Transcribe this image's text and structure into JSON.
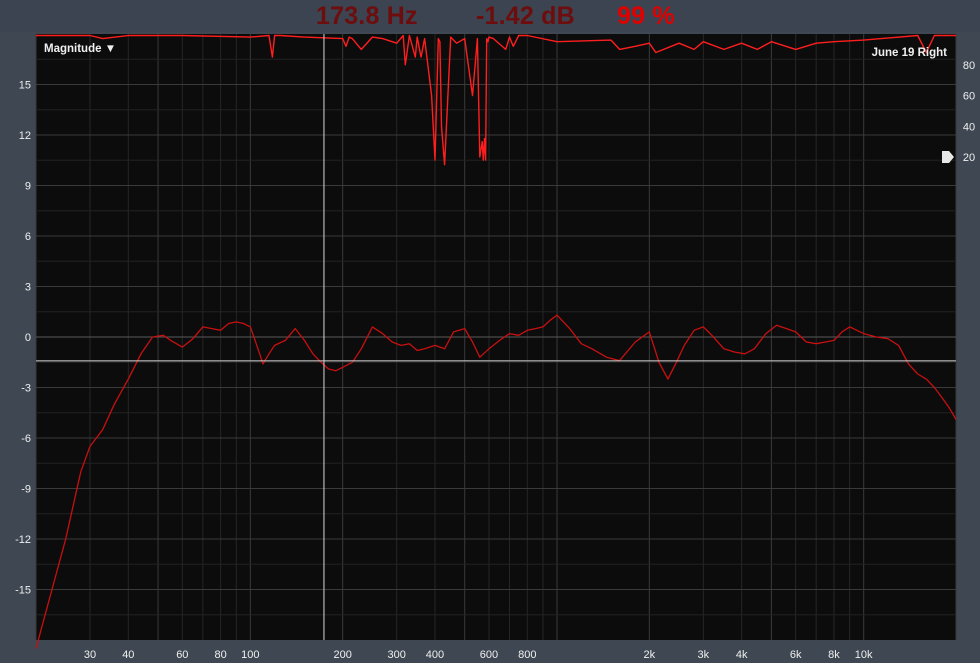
{
  "readout": {
    "frequency": "173.8 Hz",
    "level": "-1.42 dB",
    "coherence": "99 %",
    "frequency_color": "#6d0d0d",
    "level_color": "#6d0d0d",
    "coherence_color": "#e00000"
  },
  "chart_data": {
    "type": "line",
    "title": "",
    "view_menu": "Magnitude ▼",
    "trace_name": "June 19 Right",
    "xscale": "log",
    "xlim": [
      20,
      20000
    ],
    "ylim": [
      -18,
      18
    ],
    "y_ticks": [
      15,
      12,
      9,
      6,
      3,
      0,
      -3,
      -6,
      -9,
      -12,
      -15
    ],
    "x_tick_values": [
      30,
      40,
      60,
      80,
      100,
      200,
      300,
      400,
      600,
      800,
      2000,
      3000,
      4000,
      6000,
      8000,
      10000
    ],
    "x_tick_labels": [
      "30",
      "40",
      "60",
      "80",
      "100",
      "200",
      "300",
      "400",
      "600",
      "800",
      "2k",
      "3k",
      "4k",
      "6k",
      "8k",
      "10k"
    ],
    "grid": true,
    "cursor": {
      "x": 173.8,
      "y": -1.42
    },
    "coherence_axis": {
      "ticks": [
        80,
        60,
        40,
        20
      ],
      "range": [
        0,
        100
      ],
      "threshold": 20
    },
    "series": [
      {
        "role": "magnitude",
        "color": "#c81010",
        "x": [
          20,
          25,
          28,
          30,
          33,
          36,
          40,
          44,
          48,
          52,
          55,
          60,
          65,
          70,
          75,
          80,
          85,
          90,
          95,
          100,
          105,
          110,
          115,
          120,
          130,
          140,
          150,
          160,
          170,
          180,
          190,
          200,
          215,
          230,
          250,
          270,
          290,
          310,
          330,
          350,
          370,
          400,
          430,
          460,
          500,
          530,
          560,
          600,
          650,
          700,
          750,
          800,
          850,
          900,
          950,
          1000,
          1100,
          1200,
          1300,
          1450,
          1600,
          1800,
          2000,
          2150,
          2300,
          2450,
          2600,
          2800,
          3000,
          3200,
          3500,
          3800,
          4100,
          4400,
          4800,
          5200,
          5600,
          6000,
          6500,
          7000,
          7500,
          8000,
          8500,
          9000,
          9500,
          10000,
          11000,
          12000,
          13000,
          14000,
          15000,
          16000,
          17000,
          18000,
          19000,
          20000
        ],
        "y": [
          -18.5,
          -12,
          -8,
          -6.5,
          -5.5,
          -4,
          -2.5,
          -1,
          0,
          0.1,
          -0.2,
          -0.6,
          -0.1,
          0.6,
          0.5,
          0.4,
          0.8,
          0.9,
          0.8,
          0.6,
          -0.5,
          -1.6,
          -1,
          -0.5,
          -0.2,
          0.5,
          -0.2,
          -1,
          -1.5,
          -1.9,
          -2,
          -1.8,
          -1.5,
          -0.7,
          0.6,
          0.2,
          -0.3,
          -0.5,
          -0.4,
          -0.8,
          -0.7,
          -0.5,
          -0.7,
          0.3,
          0.5,
          -0.3,
          -1.2,
          -0.7,
          -0.2,
          0.2,
          0.1,
          0.4,
          0.5,
          0.6,
          1,
          1.3,
          0.5,
          -0.4,
          -0.7,
          -1.2,
          -1.4,
          -0.3,
          0.3,
          -1.5,
          -2.5,
          -1.5,
          -0.5,
          0.4,
          0.6,
          0.1,
          -0.7,
          -0.9,
          -1,
          -0.7,
          0.2,
          0.7,
          0.5,
          0.3,
          -0.3,
          -0.4,
          -0.3,
          -0.2,
          0.3,
          0.6,
          0.4,
          0.2,
          0,
          -0.1,
          -0.5,
          -1.6,
          -2.2,
          -2.5,
          -3,
          -3.6,
          -4.2,
          -4.9
        ]
      },
      {
        "role": "coherence",
        "color": "#ff1e1e",
        "x": [
          20,
          30,
          33,
          40,
          60,
          100,
          115,
          118,
          120,
          125,
          150,
          200,
          205,
          210,
          215,
          230,
          250,
          270,
          300,
          315,
          320,
          330,
          345,
          350,
          360,
          370,
          390,
          400,
          410,
          415,
          420,
          430,
          450,
          470,
          500,
          530,
          550,
          560,
          570,
          575,
          580,
          585,
          590,
          595,
          600,
          620,
          680,
          700,
          720,
          750,
          800,
          1000,
          1500,
          1600,
          1800,
          2000,
          2100,
          2500,
          2800,
          3000,
          3500,
          4000,
          4500,
          5000,
          6000,
          7000,
          8000,
          10000,
          15000,
          16000,
          17000,
          20000
        ],
        "y": [
          99,
          99,
          97,
          99,
          99,
          98,
          99,
          85,
          99,
          99,
          98,
          97,
          92,
          98,
          97,
          90,
          98,
          97,
          94,
          99,
          80,
          99,
          85,
          98,
          85,
          97,
          60,
          18,
          97,
          95,
          40,
          15,
          98,
          94,
          97,
          60,
          97,
          20,
          30,
          18,
          32,
          18,
          97,
          95,
          98,
          97,
          90,
          98,
          92,
          99,
          99,
          95,
          96,
          90,
          92,
          94,
          88,
          94,
          90,
          95,
          90,
          94,
          90,
          95,
          90,
          94,
          95,
          96,
          99,
          88,
          99,
          99
        ]
      }
    ]
  }
}
